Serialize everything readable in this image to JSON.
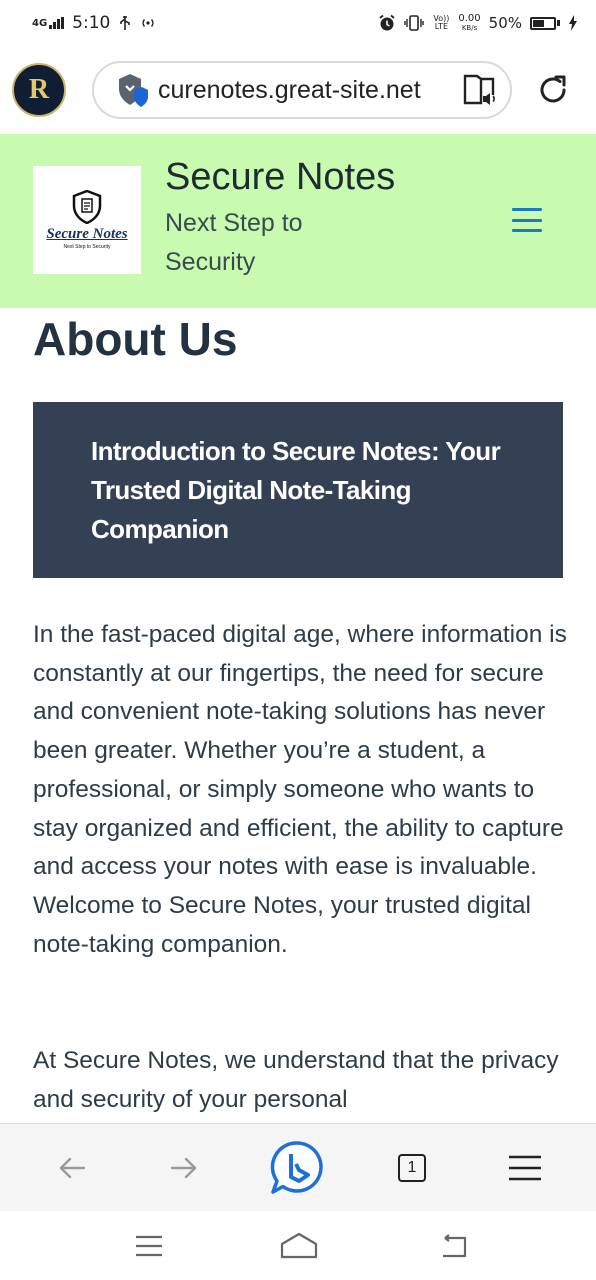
{
  "status_bar": {
    "network": "4G",
    "time": "5:10",
    "volte": "Vo)) LTE",
    "speed_value": "0.00",
    "speed_unit": "KB/s",
    "battery": "50%",
    "battery_level": 0.5,
    "icons": [
      "usb-icon",
      "hotspot-icon",
      "alarm-icon",
      "vibrate-icon",
      "charging-icon"
    ]
  },
  "browser": {
    "url": "curenotes.great-site.net",
    "site_icon_letter": "R",
    "icons": [
      "site-avatar",
      "security-shield-icon",
      "immersive-reader-icon",
      "reload-icon"
    ]
  },
  "site": {
    "logo_text": "Secure Notes",
    "logo_tagline": "Next Step to Security",
    "title": "Secure Notes",
    "tagline": "Next Step to Security",
    "accent_color": "#c8fab0",
    "menu_icon_color": "#1e78c8"
  },
  "content": {
    "page_title": "About Us",
    "intro_heading": "Introduction to Secure Notes: Your Trusted Digital Note-Taking Companion",
    "intro_bg": "#344155",
    "paragraph_1": "In the fast-paced digital age, where information is constantly at our fingertips, the need for secure and convenient note-taking solutions has never been greater. Whether you’re a student, a professional, or simply someone who wants to stay organized and efficient, the ability to capture and access your notes with ease is invaluable. Welcome to Secure Notes, your trusted digital note-taking companion.",
    "paragraph_2": "At Secure Notes, we understand that the privacy and security of your personal"
  },
  "toolbar": {
    "tab_count": "1",
    "icons": [
      "back-arrow-icon",
      "forward-arrow-icon",
      "bing-icon",
      "tabs-icon",
      "menu-icon"
    ]
  },
  "nav_bar": {
    "icons": [
      "recents-icon",
      "home-icon",
      "back-icon"
    ]
  }
}
